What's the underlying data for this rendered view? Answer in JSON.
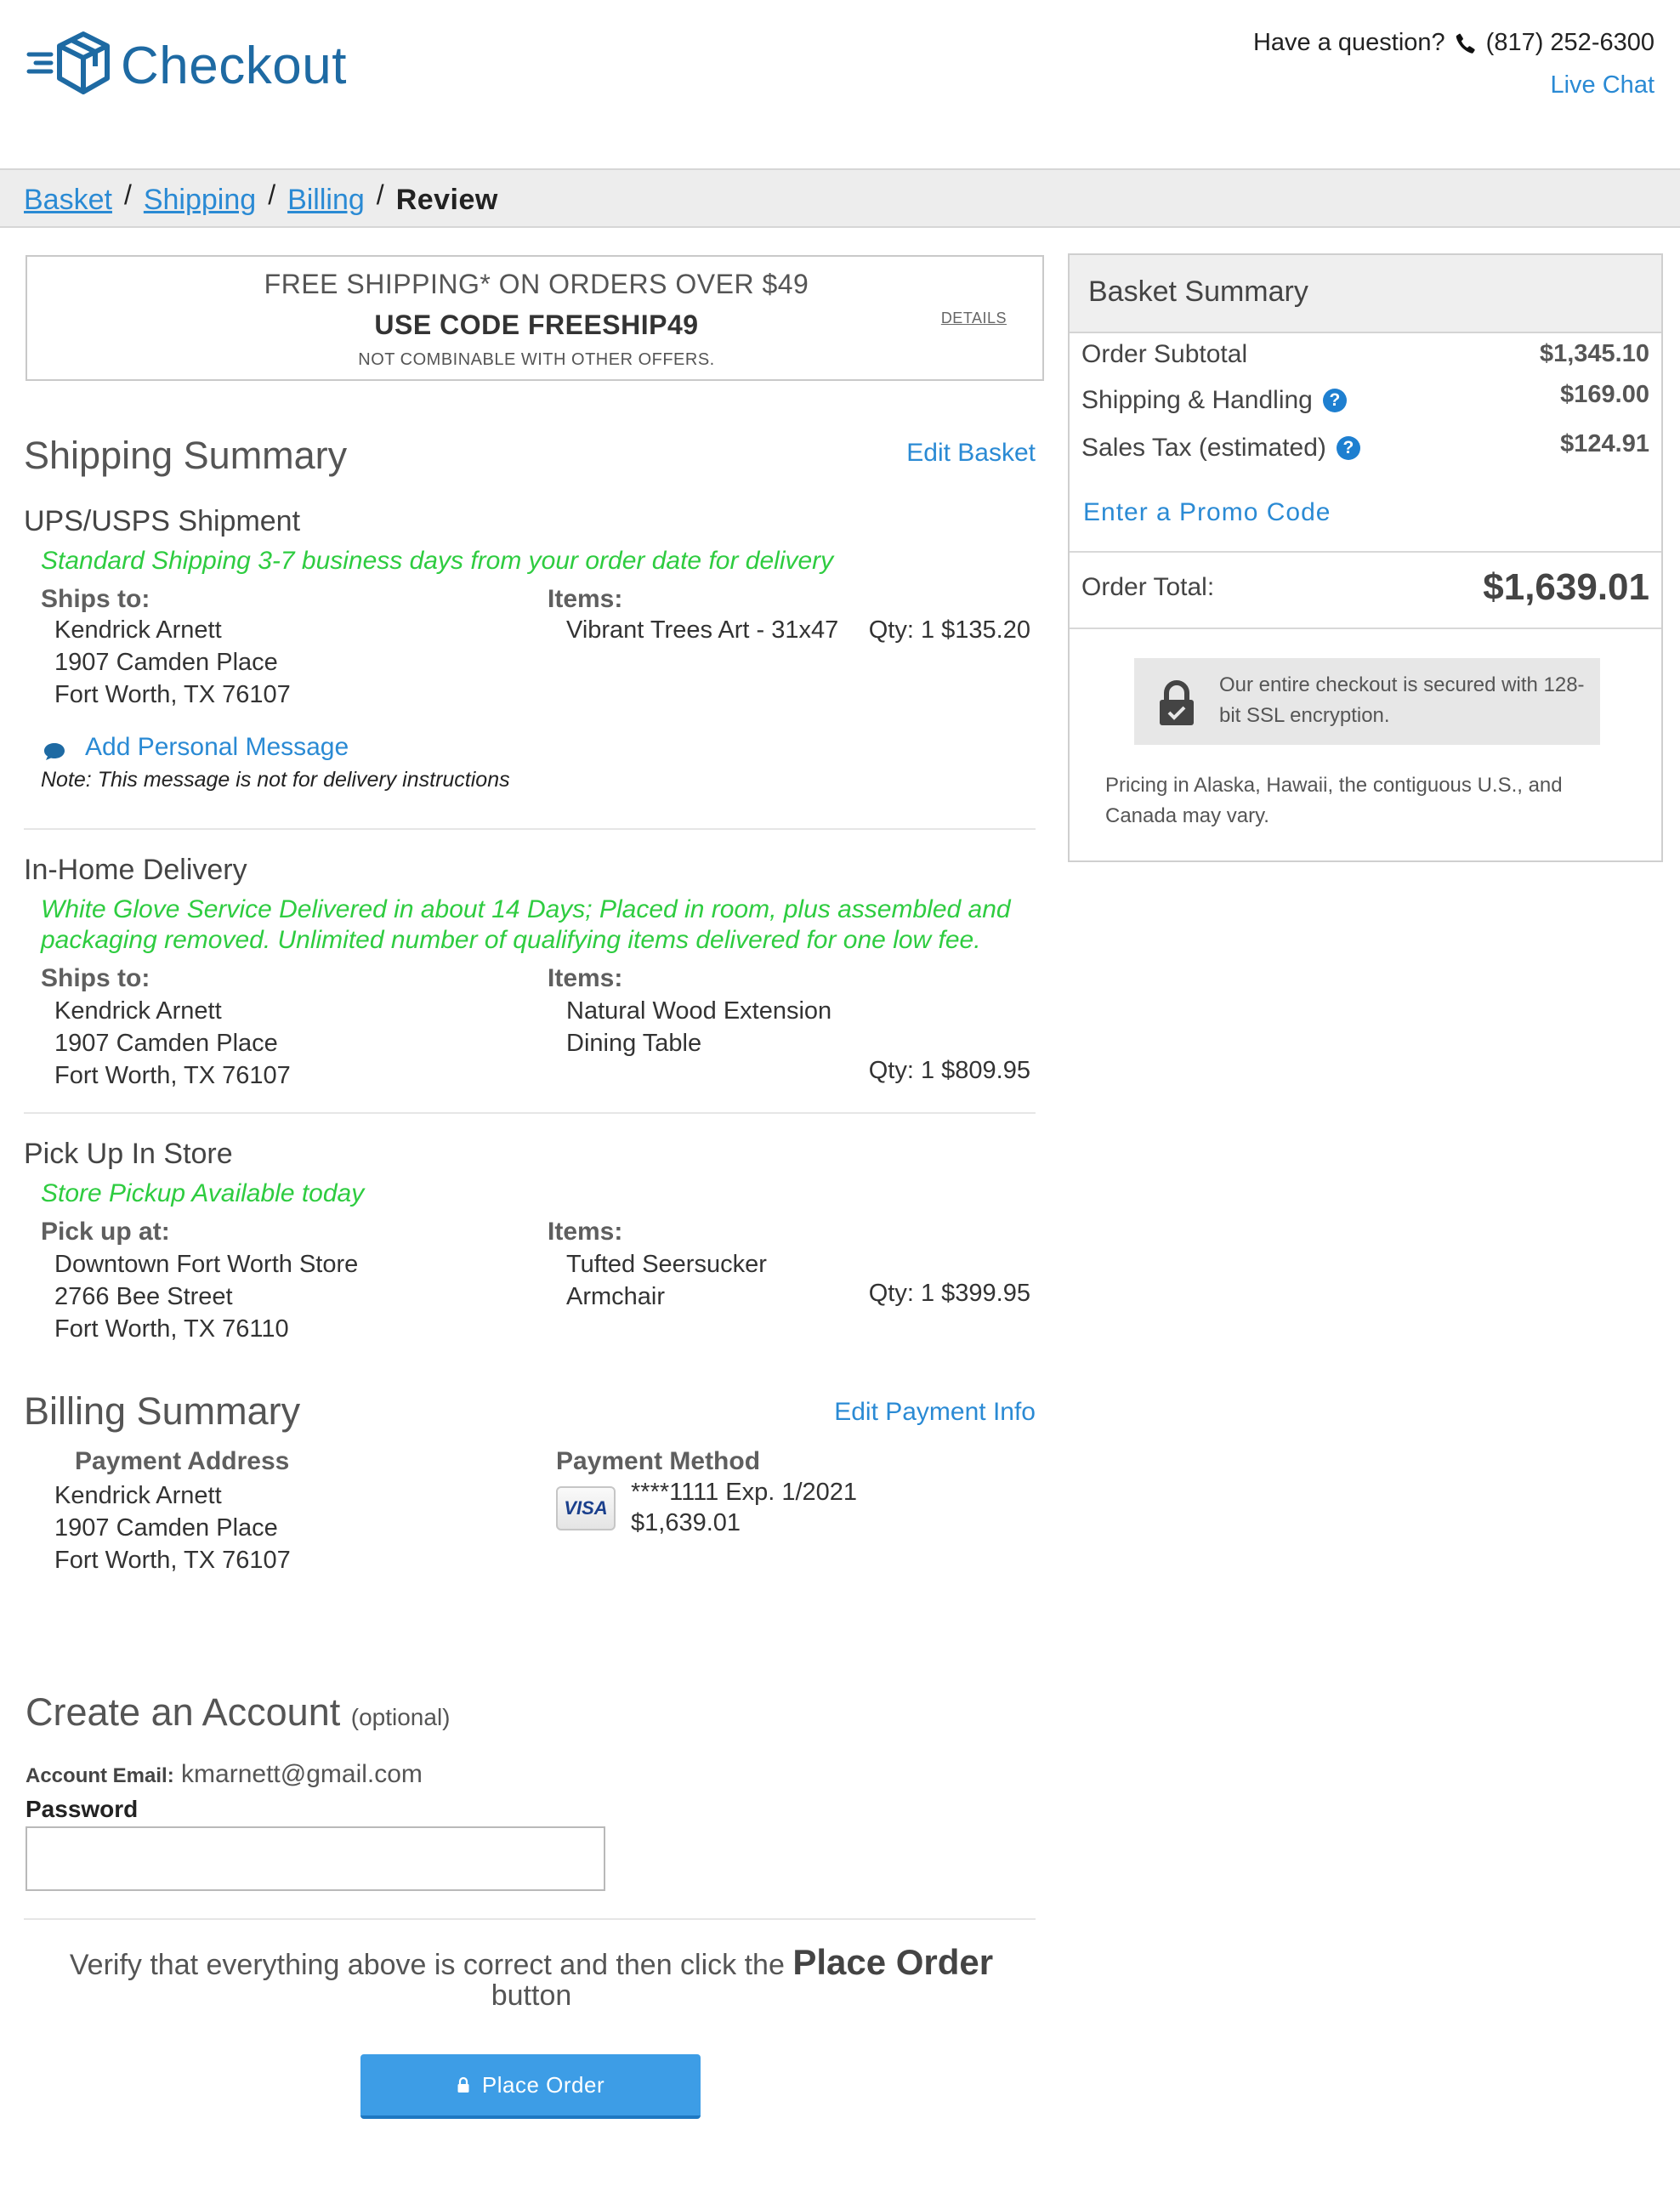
{
  "header": {
    "title": "Checkout",
    "question": "Have a question?",
    "phone": "(817) 252-6300",
    "live_chat": "Live Chat"
  },
  "breadcrumb": {
    "items": [
      "Basket",
      "Shipping",
      "Billing"
    ],
    "current": "Review"
  },
  "promo": {
    "line1": "FREE SHIPPING* ON ORDERS OVER $49",
    "line2": "USE CODE FREESHIP49",
    "line3": "NOT COMBINABLE WITH OTHER OFFERS.",
    "details": "DETAILS"
  },
  "shipping_summary": {
    "title": "Shipping Summary",
    "edit_link": "Edit Basket",
    "shipments": [
      {
        "name": "UPS/USPS Shipment",
        "method": "Standard Shipping   3-7 business days from your order date for delivery",
        "ships_label": "Ships to:",
        "address": [
          "Kendrick Arnett",
          "1907 Camden Place",
          "Fort Worth, TX 76107"
        ],
        "items_label": "Items:",
        "item": "Vibrant Trees Art - 31x47",
        "qty_price": "Qty: 1 $135.20",
        "message_link": "Add Personal Message",
        "message_note": "Note: This message is not for delivery instructions"
      },
      {
        "name": "In-Home Delivery",
        "method_line1": "White Glove Service   Delivered in about 14 Days; Placed in room, plus assembled and",
        "method_line2": "packaging removed. Unlimited number of qualifying items delivered for one low fee.",
        "ships_label": "Ships to:",
        "address": [
          "Kendrick Arnett",
          "1907 Camden Place",
          "Fort Worth, TX 76107"
        ],
        "items_label": "Items:",
        "item_line1": "Natural Wood Extension",
        "item_line2": "Dining Table",
        "qty_price": "Qty: 1 $809.95"
      },
      {
        "name": "Pick Up In Store",
        "method": "Store Pickup   Available today",
        "ships_label": "Pick up at:",
        "address": [
          "Downtown Fort Worth Store",
          "2766 Bee Street",
          "Fort Worth, TX 76110"
        ],
        "items_label": "Items:",
        "item_line1": "Tufted Seersucker",
        "item_line2": "Armchair",
        "qty_price": "Qty: 1 $399.95"
      }
    ]
  },
  "billing_summary": {
    "title": "Billing Summary",
    "edit_link": "Edit Payment Info",
    "address_label": "Payment Address",
    "address": [
      "Kendrick Arnett",
      "1907 Camden Place",
      "Fort Worth, TX 76107"
    ],
    "method_label": "Payment Method",
    "card_brand": "VISA",
    "card": "****1111 Exp. 1/2021",
    "amount": "$1,639.01"
  },
  "account": {
    "title": "Create an Account",
    "optional": "(optional)",
    "email_label": "Account Email:",
    "email": "kmarnett@gmail.com",
    "password_label": "Password",
    "password_value": ""
  },
  "verify": {
    "text": "Verify that everything above is correct and then click the",
    "emphasis": "Place Order",
    "after": "button",
    "button": "Place Order"
  },
  "basket_summary": {
    "title": "Basket Summary",
    "rows": [
      {
        "label": "Order Subtotal",
        "value": "$1,345.10"
      },
      {
        "label": "Shipping & Handling",
        "value": "$169.00"
      },
      {
        "label": "Sales Tax (estimated)",
        "value": "$124.91"
      }
    ],
    "promo_link": "Enter a Promo Code",
    "total_label": "Order Total:",
    "total_value": "$1,639.01",
    "secure_text": "Our entire checkout is secured with 128-bit SSL encryption.",
    "pricing_note": "Pricing in Alaska, Hawaii, the contiguous U.S., and Canada may vary."
  },
  "colors": {
    "brand": "#1e6aa3",
    "link": "#2a8ad4",
    "green": "#2ecc40",
    "button": "#3d9de6"
  }
}
